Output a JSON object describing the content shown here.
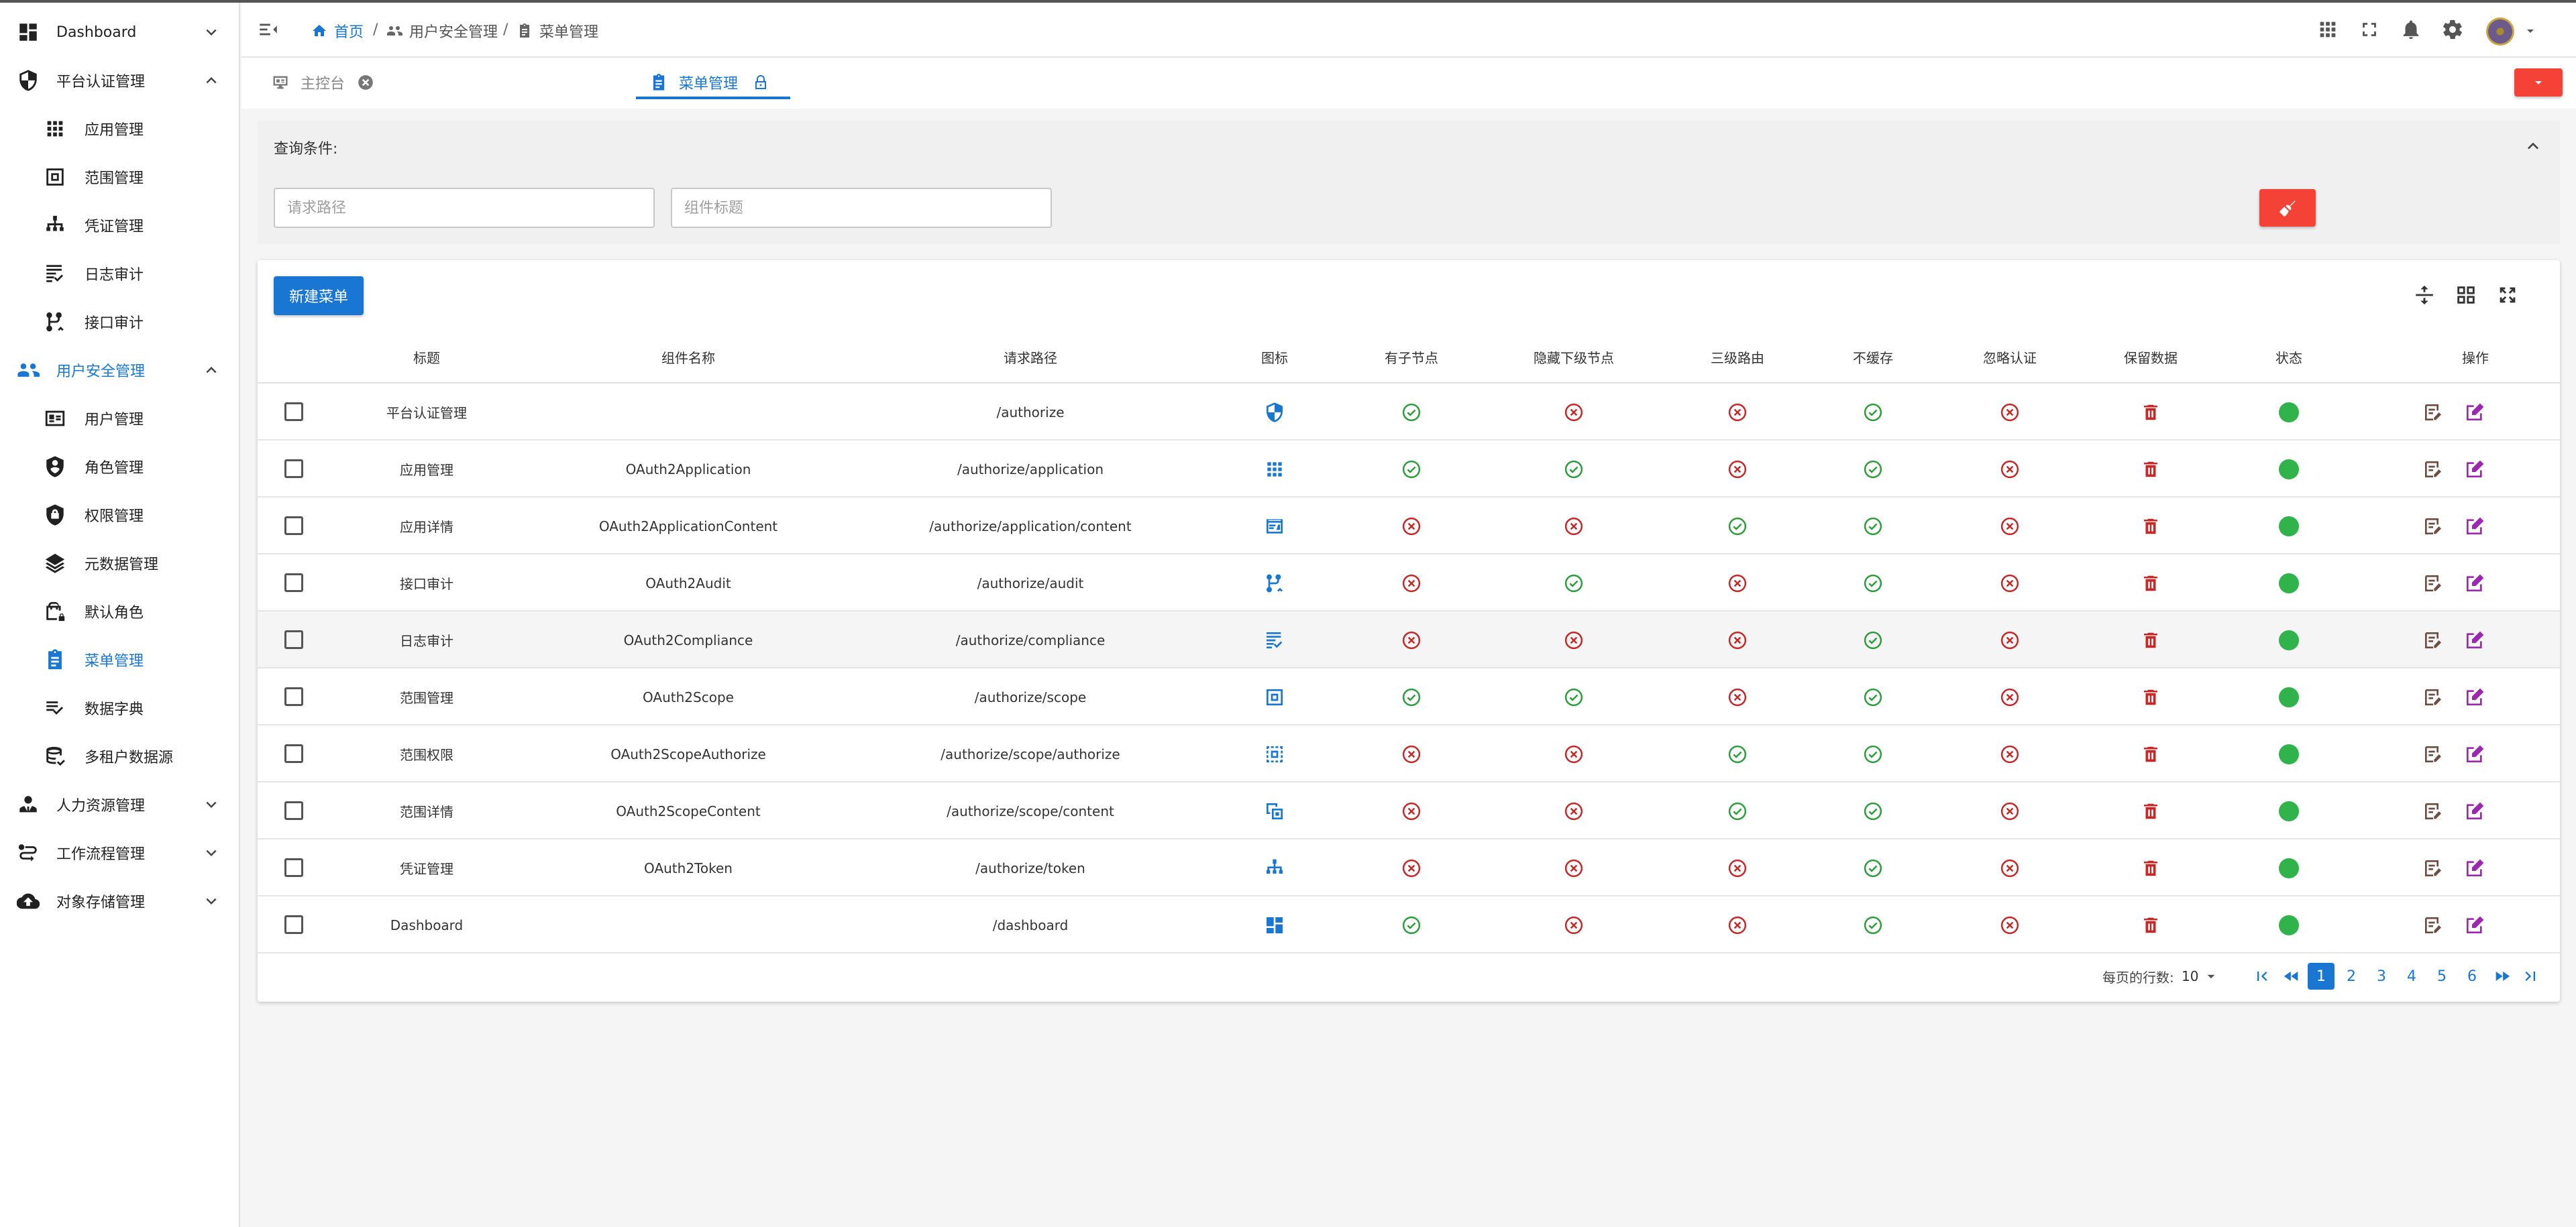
{
  "sidebar": {
    "items": [
      {
        "label": "Dashboard",
        "icon": "dashboard-icon",
        "level": "top",
        "expand": "down"
      },
      {
        "label": "平台认证管理",
        "icon": "shield-icon",
        "level": "top",
        "expand": "up"
      },
      {
        "label": "应用管理",
        "icon": "apps-grid-icon",
        "level": "sub"
      },
      {
        "label": "范围管理",
        "icon": "scope-frame-icon",
        "level": "sub"
      },
      {
        "label": "凭证管理",
        "icon": "sitemap-icon",
        "level": "sub"
      },
      {
        "label": "日志审计",
        "icon": "list-check-icon",
        "level": "sub"
      },
      {
        "label": "接口审计",
        "icon": "api-branch-icon",
        "level": "sub"
      },
      {
        "label": "用户安全管理",
        "icon": "users-group-icon",
        "level": "top",
        "expand": "up",
        "active": true
      },
      {
        "label": "用户管理",
        "icon": "id-card-icon",
        "level": "sub"
      },
      {
        "label": "角色管理",
        "icon": "account-shield-icon",
        "level": "sub"
      },
      {
        "label": "权限管理",
        "icon": "shield-lock-icon",
        "level": "sub"
      },
      {
        "label": "元数据管理",
        "icon": "layers-icon",
        "level": "sub"
      },
      {
        "label": "默认角色",
        "icon": "bag-lock-icon",
        "level": "sub"
      },
      {
        "label": "菜单管理",
        "icon": "clipboard-list-icon",
        "level": "sub",
        "active": true
      },
      {
        "label": "数据字典",
        "icon": "format-list-check-icon",
        "level": "sub"
      },
      {
        "label": "多租户数据源",
        "icon": "database-check-icon",
        "level": "sub"
      },
      {
        "label": "人力资源管理",
        "icon": "account-tie-icon",
        "level": "top",
        "expand": "down"
      },
      {
        "label": "工作流程管理",
        "icon": "workflow-icon",
        "level": "top",
        "expand": "down"
      },
      {
        "label": "对象存储管理",
        "icon": "cloud-upload-icon",
        "level": "top",
        "expand": "down"
      }
    ]
  },
  "breadcrumb": {
    "home": "首页",
    "level1": "用户安全管理",
    "level2": "菜单管理",
    "separator": "/"
  },
  "tabs": [
    {
      "label": "主控台",
      "icon": "monitor-dashboard-icon",
      "trail": "close-circle-icon"
    },
    {
      "label": "菜单管理",
      "icon": "clipboard-list-icon",
      "trail": "lock-icon",
      "active": true
    }
  ],
  "query": {
    "title": "查询条件:",
    "path_placeholder": "请求路径",
    "title_placeholder": "组件标题"
  },
  "toolbar": {
    "new_label": "新建菜单"
  },
  "table": {
    "headers": {
      "title": "标题",
      "component": "组件名称",
      "path": "请求路径",
      "icon": "图标",
      "has_children": "有子节点",
      "hide_children": "隐藏下级节点",
      "level3": "三级路由",
      "no_cache": "不缓存",
      "ignore_auth": "忽略认证",
      "reserved": "保留数据",
      "status": "状态",
      "actions": "操作"
    },
    "rows": [
      {
        "title": "平台认证管理",
        "component": "",
        "path": "/authorize",
        "icon": "shield-icon",
        "has_children": true,
        "hide_children": false,
        "level3": false,
        "no_cache": true,
        "ignore_auth": false,
        "status": "enabled"
      },
      {
        "title": "应用管理",
        "component": "OAuth2Application",
        "path": "/authorize/application",
        "icon": "apps-grid-icon",
        "has_children": true,
        "hide_children": true,
        "level3": false,
        "no_cache": true,
        "ignore_auth": false,
        "status": "enabled"
      },
      {
        "title": "应用详情",
        "component": "OAuth2ApplicationContent",
        "path": "/authorize/application/content",
        "icon": "card-details-icon",
        "has_children": false,
        "hide_children": false,
        "level3": true,
        "no_cache": true,
        "ignore_auth": false,
        "status": "enabled"
      },
      {
        "title": "接口审计",
        "component": "OAuth2Audit",
        "path": "/authorize/audit",
        "icon": "api-branch-icon",
        "has_children": false,
        "hide_children": true,
        "level3": false,
        "no_cache": true,
        "ignore_auth": false,
        "status": "enabled"
      },
      {
        "title": "日志审计",
        "component": "OAuth2Compliance",
        "path": "/authorize/compliance",
        "icon": "list-check-icon",
        "has_children": false,
        "hide_children": false,
        "level3": false,
        "no_cache": true,
        "ignore_auth": false,
        "status": "enabled",
        "highlight": true
      },
      {
        "title": "范围管理",
        "component": "OAuth2Scope",
        "path": "/authorize/scope",
        "icon": "scope-frame-icon",
        "has_children": true,
        "hide_children": true,
        "level3": false,
        "no_cache": true,
        "ignore_auth": false,
        "status": "enabled"
      },
      {
        "title": "范围权限",
        "component": "OAuth2ScopeAuthorize",
        "path": "/authorize/scope/authorize",
        "icon": "select-dotted-icon",
        "has_children": false,
        "hide_children": false,
        "level3": true,
        "no_cache": true,
        "ignore_auth": false,
        "status": "enabled"
      },
      {
        "title": "范围详情",
        "component": "OAuth2ScopeContent",
        "path": "/authorize/scope/content",
        "icon": "select-compare-icon",
        "has_children": false,
        "hide_children": false,
        "level3": true,
        "no_cache": true,
        "ignore_auth": false,
        "status": "enabled"
      },
      {
        "title": "凭证管理",
        "component": "OAuth2Token",
        "path": "/authorize/token",
        "icon": "sitemap-icon",
        "has_children": false,
        "hide_children": false,
        "level3": false,
        "no_cache": true,
        "ignore_auth": false,
        "status": "enabled"
      },
      {
        "title": "Dashboard",
        "component": "",
        "path": "/dashboard",
        "icon": "dashboard-icon",
        "has_children": true,
        "hide_children": false,
        "level3": false,
        "no_cache": true,
        "ignore_auth": false,
        "status": "enabled"
      }
    ]
  },
  "pagination": {
    "rows_label": "每页的行数:",
    "rows_per_page": "10",
    "pages": [
      "1",
      "2",
      "3",
      "4",
      "5",
      "6"
    ],
    "current": "1"
  },
  "colors": {
    "primary": "#1976d2",
    "danger": "#f44336",
    "ok": "#2e9d3d",
    "no": "#c62828",
    "status_dot": "#2fb34a",
    "edit_purple": "#9c27b0",
    "edit_brown": "#6d4c41"
  }
}
